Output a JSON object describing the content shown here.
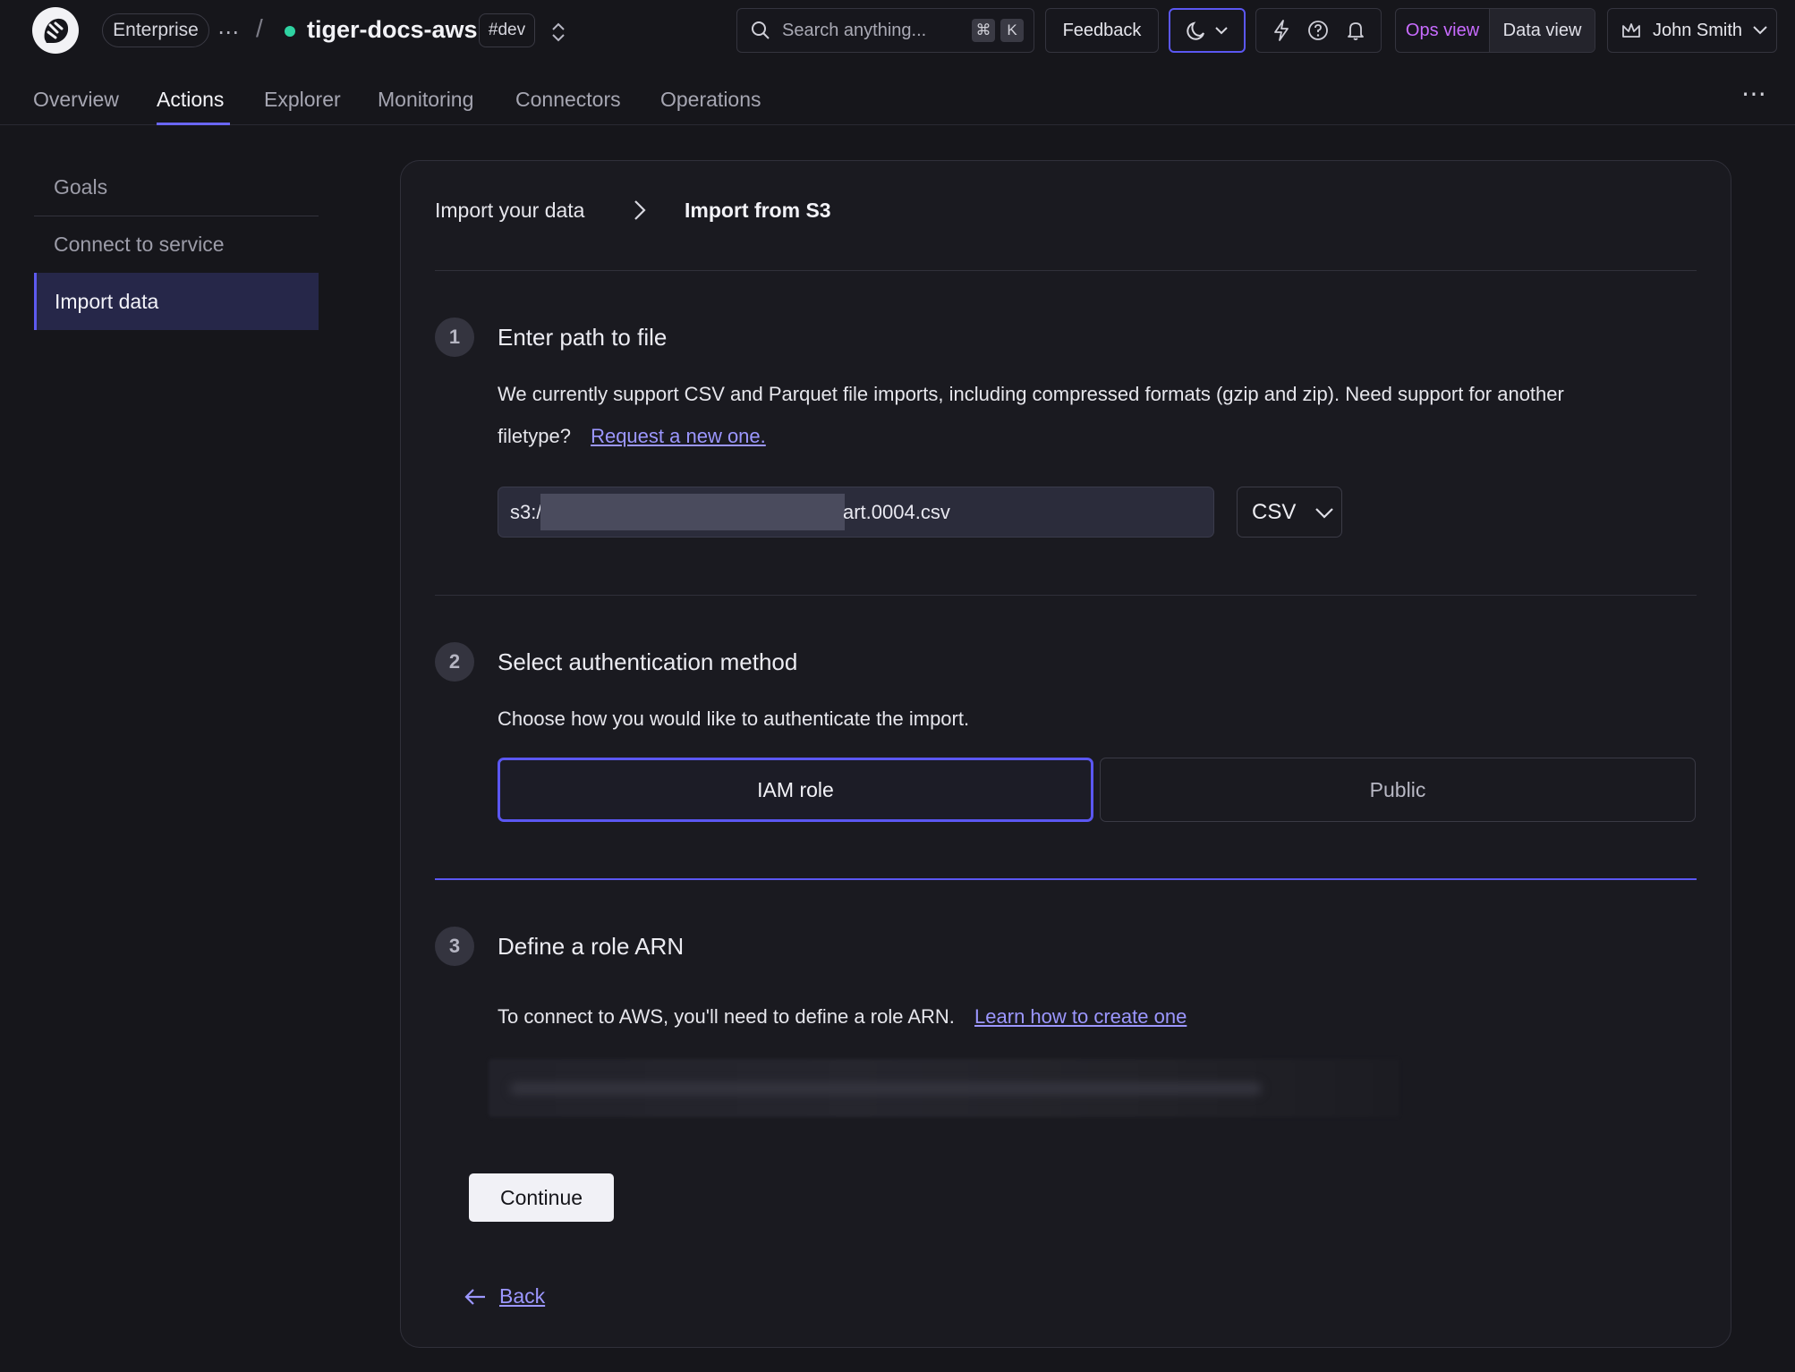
{
  "header": {
    "plan_badge": "Enterprise",
    "project_name": "tiger-docs-aws",
    "env_badge": "#dev",
    "search_placeholder": "Search anything...",
    "search_shortcut_cmd": "⌘",
    "search_shortcut_key": "K",
    "feedback_label": "Feedback",
    "ops_view_label": "Ops view",
    "data_view_label": "Data view",
    "user_name": "John Smith",
    "status_color": "#2fd3a2",
    "ops_view_color": "#c86bff",
    "accent_color": "#5b57f2"
  },
  "tabs": [
    "Overview",
    "Actions",
    "Explorer",
    "Monitoring",
    "Connectors",
    "Operations"
  ],
  "active_tab": "Actions",
  "sidebar": {
    "items": [
      "Goals",
      "Connect to service",
      "Import data"
    ],
    "active_item": "Import data"
  },
  "breadcrumb": {
    "parent": "Import your data",
    "current": "Import from S3"
  },
  "step1": {
    "number": "1",
    "title": "Enter path to file",
    "description": "We currently support CSV and Parquet file imports, including compressed formats (gzip and zip). Need support for another",
    "description_line2": "filetype?",
    "link_text": "Request a new one.",
    "path_prefix": "s3:/",
    "path_suffix": "art.0004.csv",
    "file_format": "CSV"
  },
  "step2": {
    "number": "2",
    "title": "Select authentication method",
    "description": "Choose how you would like to authenticate the import.",
    "options": [
      "IAM role",
      "Public"
    ],
    "selected": "IAM role"
  },
  "step3": {
    "number": "3",
    "title": "Define a role ARN",
    "description": "To connect to AWS, you'll need to define a role ARN.",
    "link_text": "Learn how to create one"
  },
  "actions": {
    "continue_label": "Continue",
    "back_label": "Back"
  }
}
